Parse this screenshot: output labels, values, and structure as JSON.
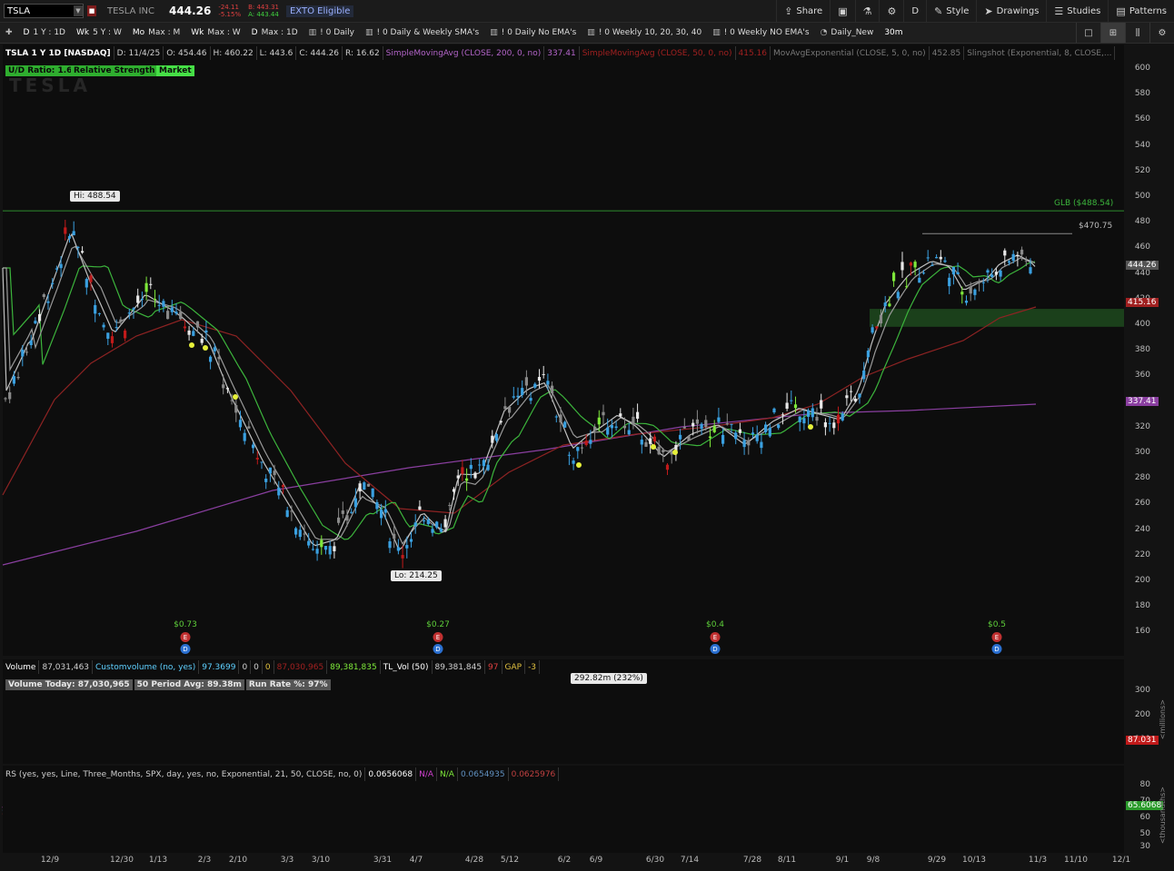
{
  "topbar": {
    "symbol": "TSLA",
    "company": "TESLA INC",
    "last_price": "444.26",
    "net_change": "-24.11",
    "pct_change": "-5.15%",
    "bid": "B: 443.31",
    "ask": "A: 443.44",
    "eto": "EXTO Eligible",
    "buttons": {
      "share": "Share",
      "style": "Style",
      "drawings": "Drawings",
      "studies": "Studies",
      "patterns": "Patterns",
      "d": "D"
    }
  },
  "timeframes": [
    {
      "k": "D",
      "v": "1 Y : 1D"
    },
    {
      "k": "Wk",
      "v": "5 Y : W"
    },
    {
      "k": "Mo",
      "v": "Max : M"
    },
    {
      "k": "Wk",
      "v": "Max : W"
    },
    {
      "k": "D",
      "v": "Max : 1D"
    }
  ],
  "flex_grids": [
    "! 0 Daily",
    "! 0 Daily & Weekly SMA's",
    "! 0 Daily No EMA's",
    "! 0 Weekly 10, 20, 30, 40",
    "! 0 Weekly NO EMA's",
    "Daily_New"
  ],
  "interval": "30m",
  "main_info": {
    "title": "TSLA 1 Y 1D [NASDAQ]",
    "date": "D: 11/4/25",
    "open": "O: 454.46",
    "high": "H: 460.22",
    "low": "L: 443.6",
    "close": "C: 444.26",
    "range": "R: 16.62",
    "sma200": "SimpleMovingAvg (CLOSE, 200, 0, no)",
    "sma200_val": "337.41",
    "sma50": "SimpleMovingAvg (CLOSE, 50, 0, no)",
    "sma50_val": "415.16",
    "ema5": "MovAvgExponential (CLOSE, 5, 0, no)",
    "ema5_val": "452.85",
    "slingshot": "Slingshot (Exponential, 8, CLOSE,..."
  },
  "badges": {
    "ud": "U/D Ratio: 1.6",
    "rs": "Relative Strength",
    "mkt": "Market"
  },
  "watermark": "TESLA",
  "callouts": {
    "hi": "Hi: 488.54",
    "lo": "Lo: 214.25",
    "glb": "GLB ($488.54)",
    "res": "$470.75"
  },
  "price_axis": [
    "600",
    "580",
    "560",
    "540",
    "520",
    "500",
    "480",
    "460",
    "440",
    "420",
    "400",
    "380",
    "360",
    "340",
    "320",
    "300",
    "280",
    "260",
    "240",
    "220",
    "200",
    "180",
    "160"
  ],
  "price_tags": {
    "last": "444.26",
    "sma50": "415.16",
    "sma200": "337.41"
  },
  "dividends": [
    "$0.73",
    "$0.27",
    "$0.4",
    "$0.5"
  ],
  "volume_info": {
    "label": "Volume",
    "value": "87,031,463",
    "custom": "Customvolume (no, yes)",
    "custom_val": "97.3699",
    "z1": "0",
    "z2": "0",
    "z3": "0",
    "red_val": "87,030,965",
    "green_val": "89,381,835",
    "tl": "TL_Vol (50)",
    "tl_val": "89,381,845",
    "n97": "97",
    "gap": "GAP",
    "gap_val": "-3"
  },
  "volume_sub": {
    "today": "Volume Today: 87,030,965",
    "avg": "50 Period Avg: 89.38m",
    "run": "Run Rate %: 97%"
  },
  "volume_callout": "292.82m (232%)",
  "volume_axis": [
    "300",
    "200",
    "100"
  ],
  "volume_tag": "87.031",
  "volume_unit": "<millions>",
  "rs_info": {
    "label": "RS (yes, yes, Line, Three_Months, SPX, day, yes, no, Exponential, 21, 50, CLOSE, no, 0)",
    "v1": "0.0656068",
    "na1": "N/A",
    "na2": "N/A",
    "v2": "0.0654935",
    "v3": "0.0625976"
  },
  "rs_axis": [
    "80",
    "70",
    "60",
    "50",
    "30"
  ],
  "rs_tag": "65.6068",
  "rs_unit": "<thousandths>",
  "x_axis": [
    "12/9",
    "12/30",
    "1/13",
    "2/3",
    "2/10",
    "3/3",
    "3/10",
    "3/31",
    "4/7",
    "4/28",
    "5/12",
    "6/2",
    "6/9",
    "6/30",
    "7/14",
    "7/28",
    "8/11",
    "9/1",
    "9/8",
    "9/29",
    "10/13",
    "11/3",
    "11/10",
    "12/1"
  ],
  "colors": {
    "up": "#3aa0e0",
    "down": "#8a8a8a",
    "strong_up": "#7ee83a",
    "strong_down": "#c01a1a",
    "ema_green": "#3cb43c",
    "sma_red": "#8e2323",
    "sma_purple": "#8a3fa0"
  }
}
